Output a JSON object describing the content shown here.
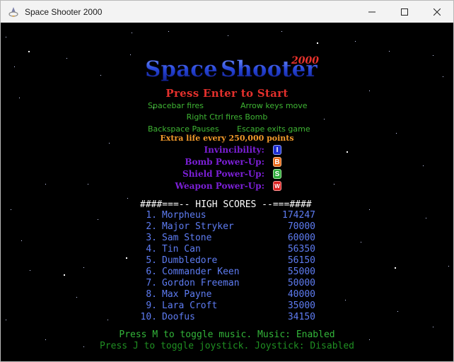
{
  "window": {
    "title": "Space Shooter 2000"
  },
  "logo": {
    "word1": "Space",
    "word2": "Shooter",
    "year": "2000"
  },
  "press_start": "Press Enter to Start",
  "instructions": {
    "spacebar": "Spacebar fires",
    "arrows": "Arrow keys move",
    "rctrl": "Right Ctrl fires Bomb",
    "backspace": "Backspace Pauses",
    "escape": "Escape exits game"
  },
  "extra_life": "Extra life every 250,000 points",
  "powerups": [
    {
      "label": "Invincibility:",
      "letter": "I",
      "color": "#1f2fd1"
    },
    {
      "label": "Bomb Power-Up:",
      "letter": "B",
      "color": "#e8691a"
    },
    {
      "label": "Shield Power-Up:",
      "letter": "S",
      "color": "#2faa3c"
    },
    {
      "label": "Weapon Power-Up:",
      "letter": "W",
      "color": "#d92323"
    }
  ],
  "high_scores": {
    "header": "####===-- HIGH SCORES --===####",
    "entries": [
      {
        "rank": "1.",
        "name": "Morpheus",
        "score": "174247"
      },
      {
        "rank": "2.",
        "name": "Major Stryker",
        "score": "70000"
      },
      {
        "rank": "3.",
        "name": "Sam Stone",
        "score": "60000"
      },
      {
        "rank": "4.",
        "name": "Tin Can",
        "score": "56350"
      },
      {
        "rank": "5.",
        "name": "Dumbledore",
        "score": "56150"
      },
      {
        "rank": "6.",
        "name": "Commander Keen",
        "score": "55000"
      },
      {
        "rank": "7.",
        "name": "Gordon Freeman",
        "score": "50000"
      },
      {
        "rank": "8.",
        "name": "Max Payne",
        "score": "40000"
      },
      {
        "rank": "9.",
        "name": "Lara Croft",
        "score": "35000"
      },
      {
        "rank": "10.",
        "name": "Doofus",
        "score": "34150"
      }
    ]
  },
  "footer": {
    "music": "Press M to toggle music. Music: Enabled",
    "joystick": "Press J to toggle joystick. Joystick: Disabled"
  }
}
